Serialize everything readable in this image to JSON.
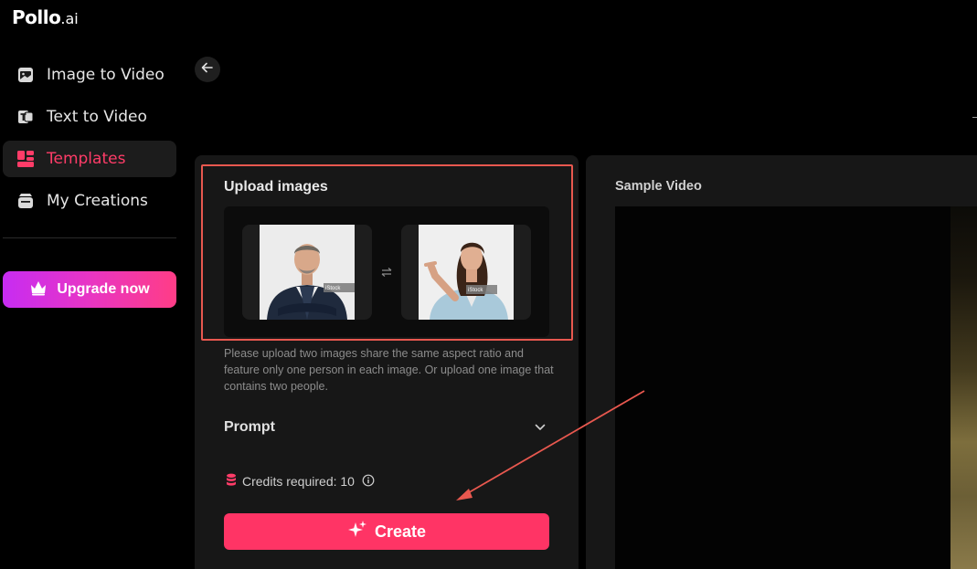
{
  "brand": {
    "name": "Pollo",
    "suffix": ".ai"
  },
  "sidebar": {
    "items": [
      {
        "label": "Image to Video",
        "icon": "image-icon",
        "active": false
      },
      {
        "label": "Text to Video",
        "icon": "text-icon",
        "active": false
      },
      {
        "label": "Templates",
        "icon": "templates-icon",
        "active": true
      },
      {
        "label": "My Creations",
        "icon": "creations-icon",
        "active": false
      }
    ],
    "upgrade_label": "Upgrade now"
  },
  "upload": {
    "title": "Upload images",
    "slot1_badge": "iStock",
    "slot2_badge": "iStock",
    "hint": "Please upload two images share the same aspect ratio and feature only one person in each image. Or upload one image that contains two people."
  },
  "prompt": {
    "label": "Prompt"
  },
  "credits": {
    "text": "Credits required: 10"
  },
  "create": {
    "label": "Create"
  },
  "sample": {
    "title": "Sample Video"
  },
  "colors": {
    "accent": "#ff3465",
    "active_nav": "#ff3c68",
    "highlight": "#e8584f",
    "annotation_arrow": "#e8584f"
  }
}
